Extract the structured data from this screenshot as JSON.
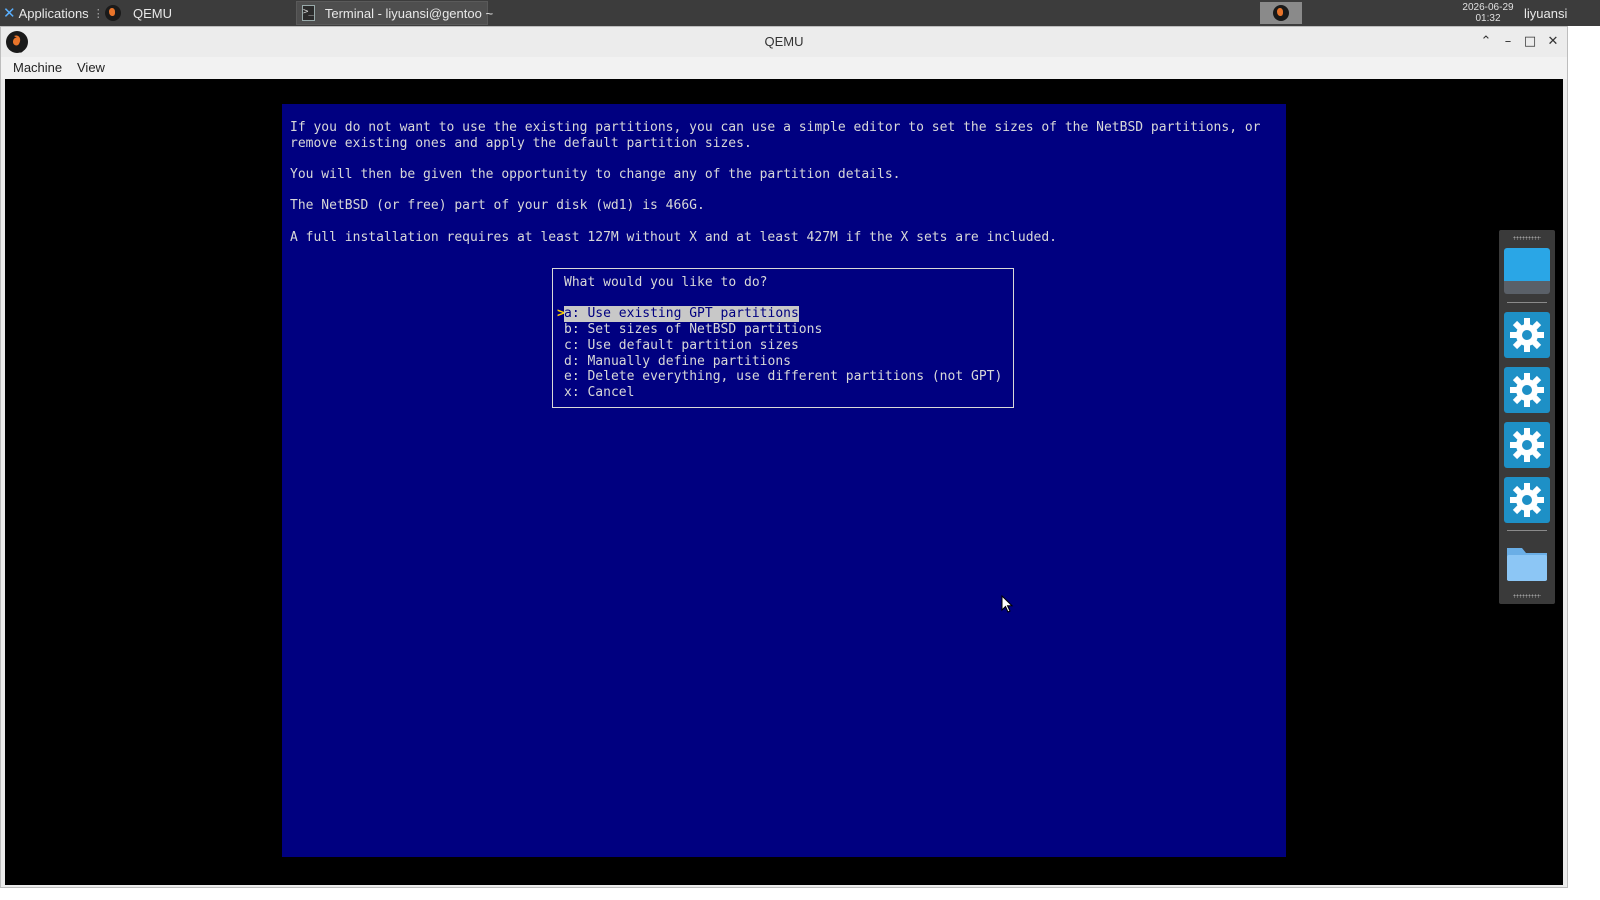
{
  "taskbar": {
    "applications_label": "Applications",
    "tasks": [
      {
        "label": "QEMU"
      },
      {
        "label": "Terminal - liyuansi@gentoo ~"
      }
    ],
    "clock": {
      "date": "2026-06-29",
      "time": "01:32"
    },
    "username": "liyuansi"
  },
  "window": {
    "title": "QEMU",
    "menu": [
      "Machine",
      "View"
    ]
  },
  "console": {
    "paragraphs": [
      "If you do not want to use the existing partitions, you can use a simple editor to set the sizes of the NetBSD partitions, or",
      "remove existing ones and apply the default partition sizes.",
      "You will then be given the opportunity to change any of the partition details.",
      "The NetBSD (or free) part of your disk (wd1) is 466G.",
      "A full installation requires at least 127M without X and at least 427M if the X sets are included."
    ],
    "dialog": {
      "question": "What would you like to do?",
      "options": [
        "a: Use existing GPT partitions",
        "b: Set sizes of NetBSD partitions",
        "c: Use default partition sizes",
        "d: Manually define partitions",
        "e: Delete everything, use different partitions (not GPT)",
        "x: Cancel"
      ],
      "selected_index": 0
    },
    "colors": {
      "background": "#000080",
      "text": "#d8d8d8",
      "highlight": "#c8c8c8",
      "arrow": "#ffd200"
    }
  },
  "dock": {
    "items": [
      "desktop-icon",
      "settings-icon",
      "settings-icon",
      "settings-icon",
      "settings-icon",
      "folder-icon"
    ]
  }
}
